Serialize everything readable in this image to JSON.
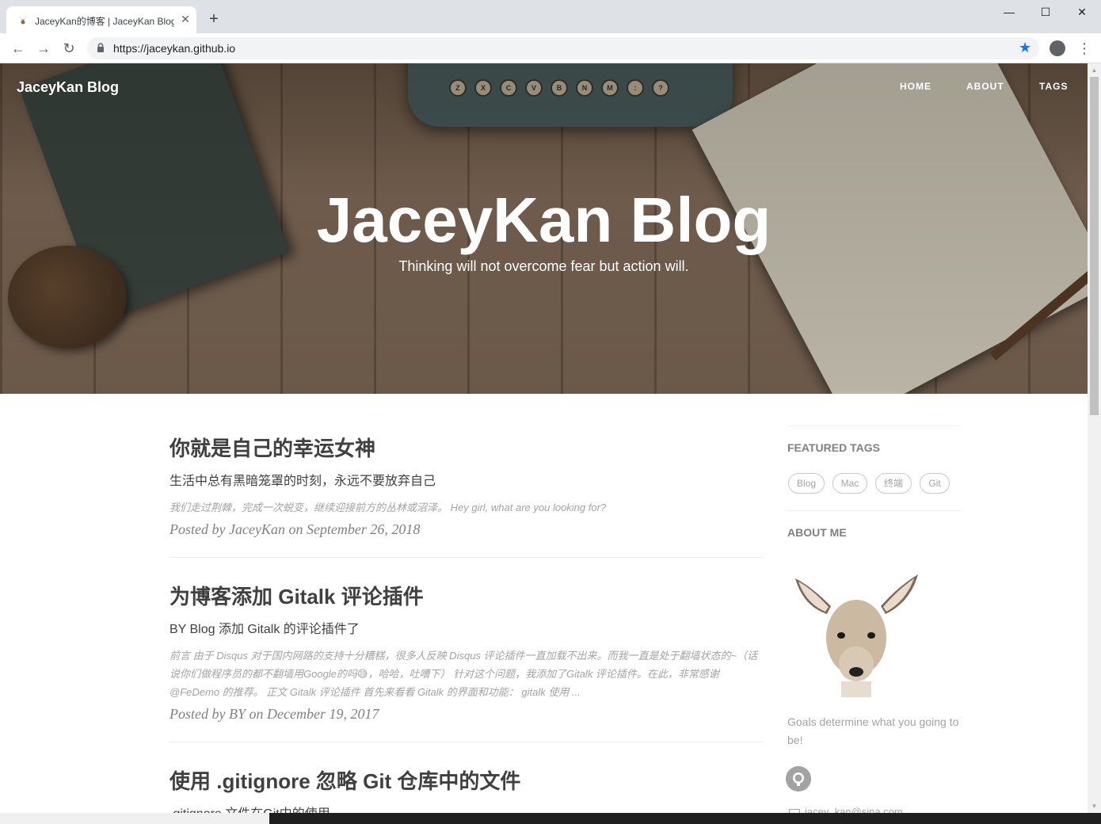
{
  "browser": {
    "tab_title": "JaceyKan的博客 | JaceyKan Blog",
    "tab_close": "✕",
    "new_tab": "+",
    "url": "https://jaceykan.github.io",
    "window_controls": {
      "minimize": "—",
      "maximize": "☐",
      "close": "✕"
    },
    "nav": {
      "back": "←",
      "forward": "→",
      "reload": "↻"
    },
    "star": "★",
    "menu": "⋮"
  },
  "site": {
    "brand": "JaceyKan Blog",
    "nav": [
      "HOME",
      "ABOUT",
      "TAGS"
    ],
    "hero_title": "JaceyKan Blog",
    "hero_subtitle": "Thinking will not overcome fear but action will."
  },
  "typewriter_keys": [
    "Z",
    "X",
    "C",
    "V",
    "B",
    "N",
    "M",
    ":",
    "?"
  ],
  "posts": [
    {
      "title": "你就是自己的幸运女神",
      "subtitle": "生活中总有黑暗笼罩的时刻，永远不要放弃自己",
      "excerpt": "我们走过荆棘，完成一次蜕变，继续迎接前方的丛林或沼泽。 Hey girl, what are you looking for?",
      "meta": "Posted by JaceyKan on September 26, 2018"
    },
    {
      "title": "为博客添加 Gitalk 评论插件",
      "subtitle": "BY Blog 添加 Gitalk 的评论插件了",
      "excerpt": "前言 由于 Disqus 对于国内网路的支持十分糟糕，很多人反映 Disqus 评论插件一直加载不出来。而我一直是处于翻墙状态的~（话说你们做程序员的都不翻墙用Google的吗😅，哈哈，吐嘈下） 针对这个问题，我添加了Gitalk 评论插件。在此，非常感谢 @FeDemo 的推荐。 正文 Gitalk 评论插件 首先来看看 Gitalk 的界面和功能： gitalk 使用 ...",
      "meta": "Posted by BY on December 19, 2017"
    },
    {
      "title": "使用 .gitignore 忽略 Git 仓库中的文件",
      "subtitle": ".gitignore 文件在Git中的使用"
    }
  ],
  "sidebar": {
    "featured_tags_heading": "FEATURED TAGS",
    "tags": [
      "Blog",
      "Mac",
      "终端",
      "Git"
    ],
    "about_heading": "ABOUT ME",
    "about_text": "Goals determine what you going to be!",
    "email": "jacey_kan@sina.com"
  },
  "icons": {
    "lock": "lock-icon",
    "github": "github-icon",
    "email": "email-icon"
  }
}
